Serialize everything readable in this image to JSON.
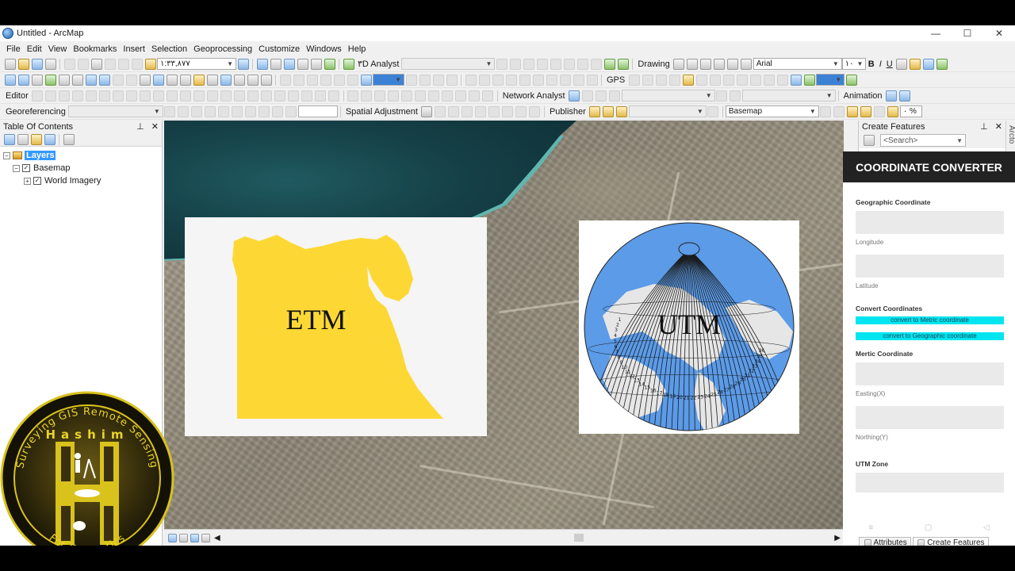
{
  "window": {
    "title": "Untitled - ArcMap",
    "minimize": "—",
    "maximize": "☐",
    "close": "✕"
  },
  "menu": [
    "File",
    "Edit",
    "View",
    "Bookmarks",
    "Insert",
    "Selection",
    "Geoprocessing",
    "Customize",
    "Windows",
    "Help"
  ],
  "toolbar": {
    "scale": "۱:۳۳,۸۷۷",
    "d_analyst": "۳D Analyst",
    "drawing": "Drawing",
    "font": "Arial",
    "font_size": "۱۰",
    "bold": "B",
    "italic": "I",
    "underline": "U",
    "gps": "GPS",
    "editor": "Editor",
    "network_analyst": "Network Analyst",
    "animation": "Animation",
    "georeferencing": "Georeferencing",
    "spatial_adjustment": "Spatial Adjustment",
    "publisher": "Publisher",
    "basemap": "Basemap",
    "transparency": "۰ %"
  },
  "toc": {
    "title": "Table Of Contents",
    "layers": [
      {
        "label": "Layers",
        "expander": "−",
        "checked": ""
      },
      {
        "label": "Basemap",
        "expander": "−",
        "checked": "✓"
      },
      {
        "label": "World Imagery",
        "expander": "+",
        "checked": "✓"
      }
    ]
  },
  "map": {
    "etm_label": "ETM",
    "utm_label": "UTM",
    "zone_numbers": [
      "1",
      "2",
      "3",
      "4",
      "5",
      "6",
      "7",
      "8",
      "9",
      "10",
      "11",
      "12",
      "13",
      "14",
      "15",
      "16",
      "17",
      "18",
      "19",
      "20",
      "21",
      "22",
      "23",
      "24",
      "25",
      "26",
      "27",
      "28",
      "29",
      "30",
      "31",
      "32",
      "33",
      "34",
      "35",
      "36"
    ]
  },
  "right_panel": {
    "title": "Create Features",
    "search_placeholder": "<Search>",
    "side_tab": "Arcto"
  },
  "converter": {
    "title": "COORDINATE CONVERTER",
    "geographic_label": "Geographic Coordinate",
    "longitude_hint": "Longitude",
    "latitude_hint": "Latitude",
    "convert_label": "Convert Coordinates",
    "to_metric_btn": "convert to Metric coordinate",
    "to_geographic_btn": "convert to Geographic coordinate",
    "metric_label": "Mertic Coordinate",
    "easting_hint": "Easting(X)",
    "northing_hint": "Northing(Y)",
    "utm_zone_label": "UTM Zone",
    "nav": [
      "≡",
      "▢",
      "◁"
    ],
    "tabs": [
      "Attributes",
      "Create Features"
    ]
  },
  "logo": {
    "name": "Hashim",
    "top_text": "Surveying  GIS  Remote Sensing",
    "bottom_text": "For Geomatics"
  },
  "colors": {
    "accent_cyan": "#00e5f0",
    "egypt_yellow": "#fdd835",
    "globe_blue": "#5b9be8",
    "selection_blue": "#3399ff"
  }
}
